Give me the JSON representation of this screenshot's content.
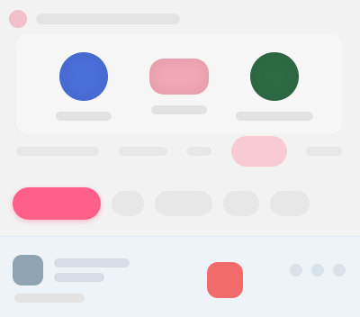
{
  "header": {
    "title": ""
  },
  "hero": {
    "items": [
      {
        "label": "",
        "icon": "blue-circle-icon",
        "color": "#4a6fd8"
      },
      {
        "label": "",
        "icon": "pink-pill-icon",
        "color": "#f2a7b6"
      },
      {
        "label": "",
        "icon": "green-circle-icon",
        "color": "#2e6b45"
      }
    ]
  },
  "subtitles": [],
  "chips": [
    {
      "label": "",
      "active": true
    },
    {
      "label": "",
      "active": false
    },
    {
      "label": "",
      "active": false
    },
    {
      "label": "",
      "active": false
    },
    {
      "label": "",
      "active": false
    }
  ],
  "list": {
    "rows": [
      {
        "title": "",
        "subtitle": ""
      }
    ]
  },
  "colors": {
    "accent": "#ff5f88",
    "badge_red": "#f26b6b",
    "blue": "#4a6fd8",
    "green": "#2e6b45",
    "soft_pink": "#f7cad4"
  }
}
